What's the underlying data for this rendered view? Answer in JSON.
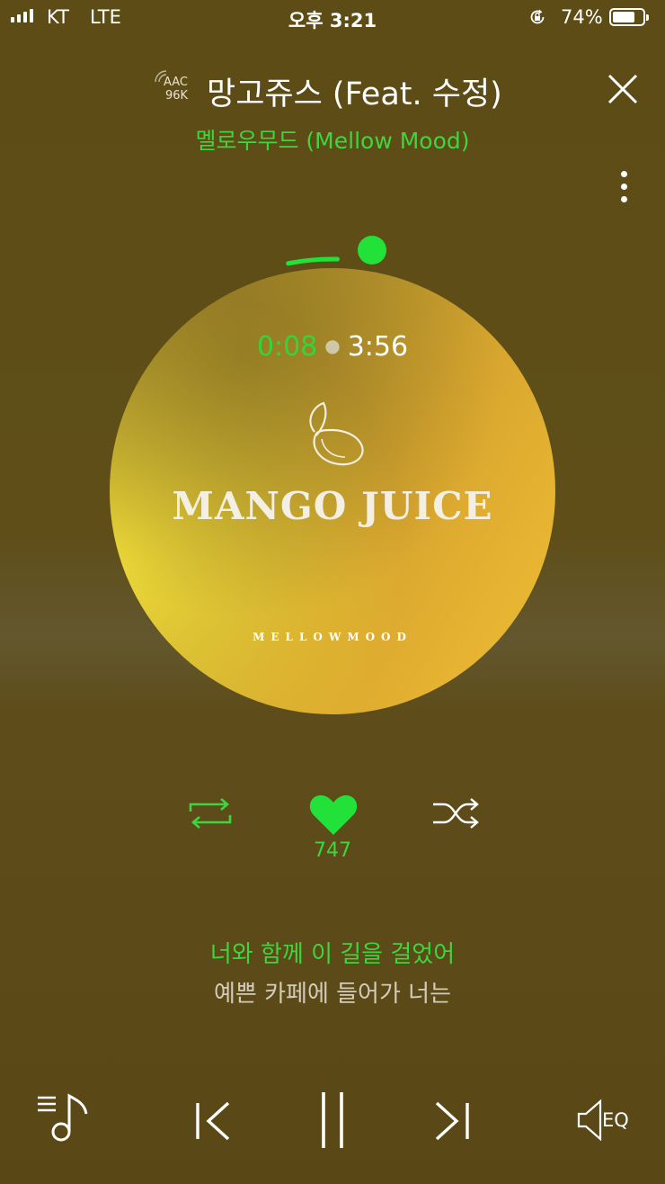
{
  "status_bar": {
    "carrier": "KT",
    "network": "LTE",
    "time": "오후 3:21",
    "battery_percent": "74%",
    "battery_level": 0.74
  },
  "header": {
    "codec_top": "AAC",
    "codec_bottom": "96K",
    "song_title": "망고쥬스 (Feat. 수정)",
    "artist": "멜로우무드 (Mellow Mood)"
  },
  "player": {
    "current_time": "0:08",
    "total_time": "3:56",
    "progress_fraction": 0.034,
    "likes": "747",
    "colors": {
      "accent": "#22e23a",
      "background": "#5d4c16"
    }
  },
  "album_art": {
    "title": "MANGO JUICE",
    "label": "MELLOWMOOD"
  },
  "lyrics": {
    "current": "너와 함께 이 길을 걸었어",
    "next": "예쁜 카페에 들어가 너는"
  },
  "bottom_bar": {
    "eq_label": "EQ"
  },
  "icons": [
    "signal-icon",
    "rotation-lock-icon",
    "battery-icon",
    "close-icon",
    "more-icon",
    "repeat-icon",
    "heart-icon",
    "shuffle-icon",
    "playlist-icon",
    "previous-icon",
    "pause-icon",
    "next-icon",
    "speaker-icon"
  ]
}
